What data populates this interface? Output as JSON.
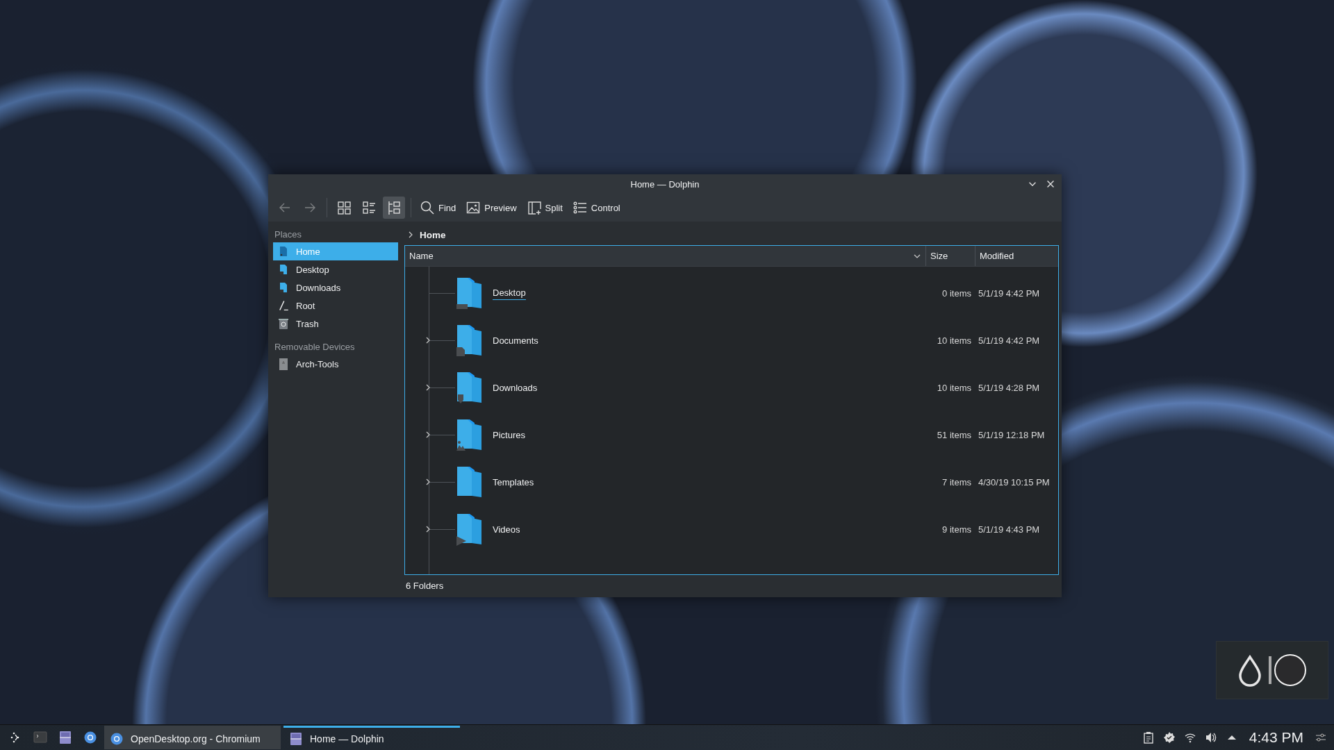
{
  "window": {
    "title": "Home — Dolphin"
  },
  "toolbar": [
    {
      "kind": "back",
      "disabled": true
    },
    {
      "kind": "forward",
      "disabled": true
    },
    {
      "kind": "icons",
      "selected": false
    },
    {
      "kind": "compact",
      "selected": false
    },
    {
      "kind": "details",
      "selected": true
    },
    {
      "kind": "find",
      "label": "Find"
    },
    {
      "kind": "preview",
      "label": "Preview"
    },
    {
      "kind": "split",
      "label": "Split"
    },
    {
      "kind": "control",
      "label": "Control"
    }
  ],
  "sidebar": {
    "sections": [
      {
        "title": "Places",
        "items": [
          {
            "label": "Home",
            "selected": true
          },
          {
            "label": "Desktop",
            "selected": false
          },
          {
            "label": "Downloads",
            "selected": false
          },
          {
            "label": "Root",
            "selected": false
          },
          {
            "label": "Trash",
            "selected": false
          }
        ]
      },
      {
        "title": "Removable Devices",
        "items": [
          {
            "label": "Arch-Tools",
            "selected": false
          }
        ]
      }
    ]
  },
  "breadcrumb": [
    "Home"
  ],
  "table": {
    "columns": [
      "Name",
      "Size",
      "Modified"
    ],
    "rows": [
      {
        "name": "Desktop",
        "expandable": false,
        "hovered": true,
        "size": "0 items",
        "modified": "5/1/19 4:42 PM"
      },
      {
        "name": "Documents",
        "expandable": true,
        "hovered": false,
        "size": "10 items",
        "modified": "5/1/19 4:42 PM"
      },
      {
        "name": "Downloads",
        "expandable": true,
        "hovered": false,
        "size": "10 items",
        "modified": "5/1/19 4:28 PM"
      },
      {
        "name": "Pictures",
        "expandable": true,
        "hovered": false,
        "size": "51 items",
        "modified": "5/1/19 12:18 PM"
      },
      {
        "name": "Templates",
        "expandable": true,
        "hovered": false,
        "size": "7 items",
        "modified": "4/30/19 10:15 PM"
      },
      {
        "name": "Videos",
        "expandable": true,
        "hovered": false,
        "size": "9 items",
        "modified": "5/1/19 4:43 PM"
      }
    ]
  },
  "status_bar": "6 Folders",
  "taskbar": {
    "tasks": [
      {
        "label": "OpenDesktop.org - Chromium",
        "selected": false
      },
      {
        "label": "Home — Dolphin",
        "selected": true
      }
    ],
    "clock": "4:43 PM"
  }
}
